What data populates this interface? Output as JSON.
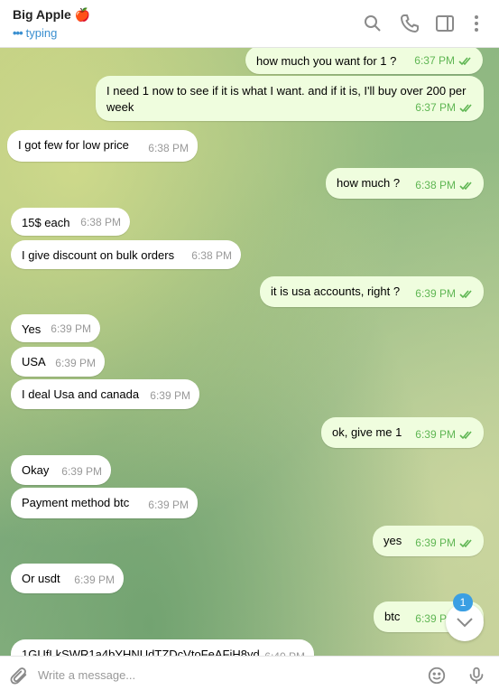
{
  "header": {
    "name": "Big Apple 🍎",
    "status": "typing",
    "status_dots": "•••"
  },
  "colors": {
    "accent": "#3a8fd0",
    "incoming_bubble": "#ffffff",
    "outgoing_bubble": "#effdde",
    "outgoing_meta": "#5fb653"
  },
  "icons": [
    "search-icon",
    "phone-icon",
    "sidebar-toggle-icon",
    "more-vertical-icon",
    "paperclip-icon",
    "emoji-icon",
    "microphone-icon",
    "chevron-down-icon",
    "double-check-icon"
  ],
  "messages": [
    {
      "dir": "out",
      "text": "how much you want for 1 ?",
      "time": "6:37 PM"
    },
    {
      "dir": "out",
      "text": "I need 1 now to see if it is what I want. and if it is, I'll buy over 200 per week",
      "time": "6:37 PM"
    },
    {
      "dir": "in",
      "text": "I got few for low price",
      "time": "6:38 PM"
    },
    {
      "dir": "out",
      "text": "how much ?",
      "time": "6:38 PM"
    },
    {
      "dir": "in",
      "text": "15$ each",
      "time": "6:38 PM"
    },
    {
      "dir": "in",
      "text": "I give discount on bulk orders",
      "time": "6:38 PM"
    },
    {
      "dir": "out",
      "text": "it is usa accounts, right ?",
      "time": "6:39 PM"
    },
    {
      "dir": "in",
      "text": "Yes",
      "time": "6:39 PM"
    },
    {
      "dir": "in",
      "text": "USA",
      "time": "6:39 PM"
    },
    {
      "dir": "in",
      "text": "I deal Usa and canada",
      "time": "6:39 PM"
    },
    {
      "dir": "out",
      "text": "ok, give me 1",
      "time": "6:39 PM"
    },
    {
      "dir": "in",
      "text": "Okay",
      "time": "6:39 PM"
    },
    {
      "dir": "in",
      "text": "Payment method btc",
      "time": "6:39 PM"
    },
    {
      "dir": "out",
      "text": "yes",
      "time": "6:39 PM"
    },
    {
      "dir": "in",
      "text": "Or usdt",
      "time": "6:39 PM"
    },
    {
      "dir": "out",
      "text": "btc",
      "time": "6:39 PM"
    },
    {
      "dir": "in",
      "text": "1GUfLkSWR1a4bYHNUdTZDcVtoFeAFiH8yd",
      "time": "6:40 PM"
    }
  ],
  "scroll": {
    "unread_count": "1"
  },
  "composer": {
    "placeholder": "Write a message..."
  }
}
